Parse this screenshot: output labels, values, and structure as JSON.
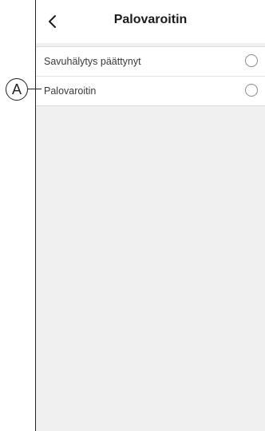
{
  "header": {
    "title": "Palovaroitin",
    "back_icon": "chevron-left-icon"
  },
  "list": {
    "items": [
      {
        "label": "Savuhälytys päättynyt",
        "selected": false
      },
      {
        "label": "Palovaroitin",
        "selected": false
      }
    ]
  },
  "annotation": {
    "label": "A",
    "color": "#222222"
  },
  "colors": {
    "background": "#f0f0f0",
    "surface": "#ffffff",
    "text": "#1b1b1b"
  }
}
